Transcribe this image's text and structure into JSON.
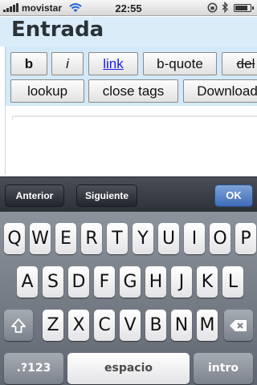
{
  "status_bar": {
    "carrier": "movistar",
    "time": "22:55",
    "icons": [
      "signal-icon",
      "wifi-icon",
      "rotation-lock-icon",
      "bluetooth-icon",
      "battery-icon"
    ],
    "battery_level": 0.85
  },
  "header": {
    "title": "Entrada"
  },
  "toolbar": {
    "row1": [
      "b",
      "i",
      "link",
      "b-quote",
      "del"
    ],
    "row2": [
      "lookup",
      "close tags",
      "Download"
    ]
  },
  "form_bar": {
    "previous": "Anterior",
    "next": "Siguiente",
    "done": "OK"
  },
  "keyboard": {
    "row1": [
      "Q",
      "W",
      "E",
      "R",
      "T",
      "Y",
      "U",
      "I",
      "O",
      "P"
    ],
    "row2": [
      "A",
      "S",
      "D",
      "F",
      "G",
      "H",
      "J",
      "K",
      "L"
    ],
    "row3": [
      "Z",
      "X",
      "C",
      "V",
      "B",
      "N",
      "M"
    ],
    "numbers": ".?123",
    "space": "espacio",
    "return": "intro"
  },
  "colors": {
    "header_bg": "#d9ecf8",
    "toolbar_bg": "#d4e9f7",
    "ok_button": "#3e6cb8",
    "keyboard_bg": "#5f6671"
  }
}
